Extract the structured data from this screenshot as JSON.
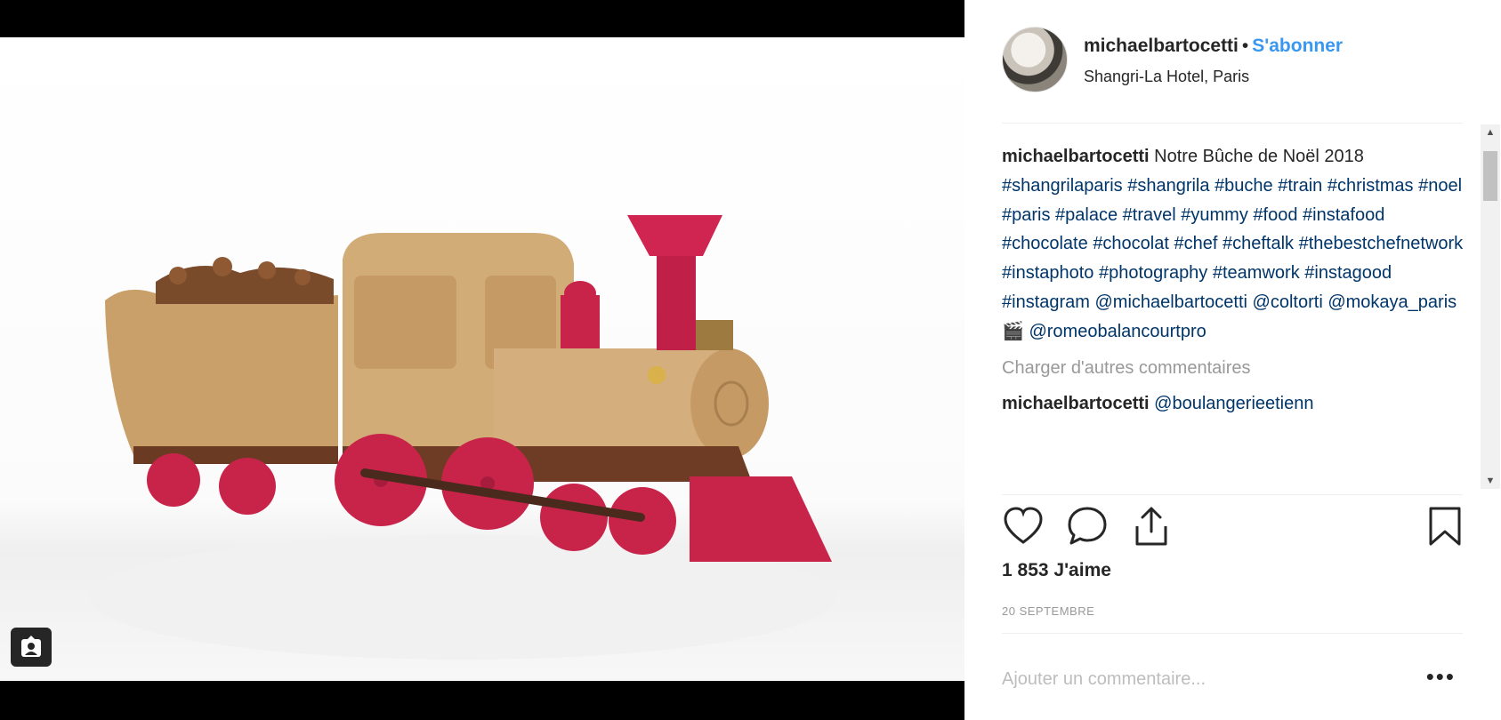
{
  "media": {
    "alt": "",
    "tag_icon": "user-tag-icon"
  },
  "header": {
    "username": "michaelbartocetti",
    "separator": "•",
    "follow_label": "S'abonner",
    "location": "Shangri-La Hotel, Paris"
  },
  "caption": {
    "username": "michaelbartocetti",
    "text": "Notre Bûche de Noël 2018",
    "hashtags": [
      "#shangrilaparis",
      "#shangrila",
      "#buche",
      "#train",
      "#christmas",
      "#noel",
      "#paris",
      "#palace",
      "#travel",
      "#yummy",
      "#food",
      "#instafood",
      "#chocolate",
      "#chocolat",
      "#chef",
      "#cheftalk",
      "#thebestchefnetwork",
      "#instaphoto",
      "#photography",
      "#teamwork",
      "#instagood",
      "#instagram"
    ],
    "mentions": [
      "@michaelbartocetti",
      "@coltorti",
      "@mokaya_paris",
      "🎬",
      "@romeobalancourtpro"
    ]
  },
  "load_more_label": "Charger d'autres commentaires",
  "comment": {
    "username": "michaelbartocetti",
    "text": "@boulangerieetienn"
  },
  "actions": {
    "like_icon": "heart-icon",
    "comment_icon": "comment-icon",
    "share_icon": "share-icon",
    "save_icon": "bookmark-icon"
  },
  "likes_label": "1 853 J'aime",
  "date_label": "20 SEPTEMBRE",
  "add_comment": {
    "placeholder": "Ajouter un commentaire...",
    "more_label": "•••"
  },
  "colors": {
    "link": "#3897f0",
    "hashtag": "#003569",
    "text": "#262626",
    "muted": "#999999"
  }
}
